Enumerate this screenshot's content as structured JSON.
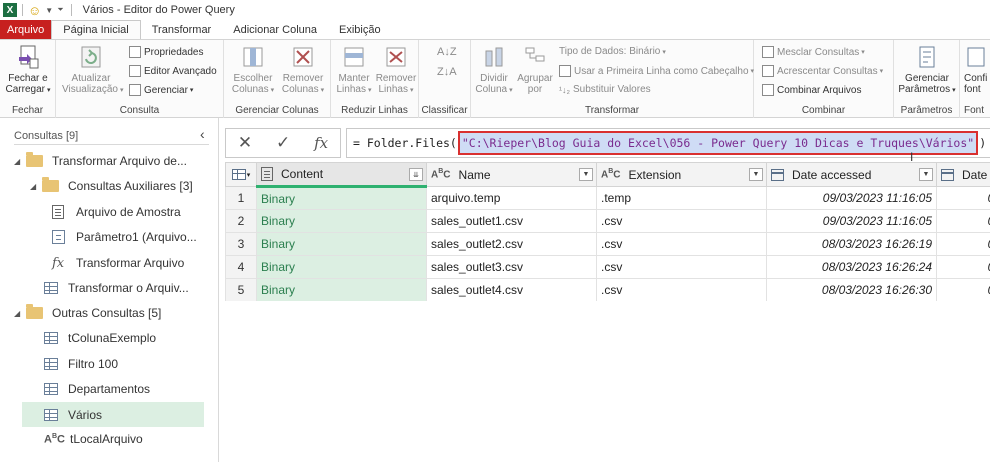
{
  "window": {
    "title": "Vários - Editor do Power Query",
    "app_logo": "X"
  },
  "ribbon_tabs": [
    {
      "label": "Arquivo"
    },
    {
      "label": "Página Inicial"
    },
    {
      "label": "Transformar"
    },
    {
      "label": "Adicionar Coluna"
    },
    {
      "label": "Exibição"
    }
  ],
  "ribbon": {
    "fechar": {
      "button": "Fechar e\nCarregar",
      "group": "Fechar"
    },
    "consulta": {
      "atualizar": "Atualizar\nVisualização",
      "propriedades": "Propriedades",
      "editor_avancado": "Editor Avançado",
      "gerenciar": "Gerenciar",
      "group": "Consulta"
    },
    "gerenciar_colunas": {
      "escolher": "Escolher\nColunas",
      "remover": "Remover\nColunas",
      "group": "Gerenciar Colunas"
    },
    "reduzir_linhas": {
      "manter": "Manter\nLinhas",
      "remover": "Remover\nLinhas",
      "group": "Reduzir Linhas"
    },
    "classificar": {
      "group": "Classificar"
    },
    "transformar": {
      "dividir": "Dividir\nColuna",
      "agrupar": "Agrupar\npor",
      "tipo_dados": "Tipo de Dados: Binário",
      "primeira_linha": "Usar a Primeira Linha como Cabeçalho",
      "substituir": "Substituir Valores",
      "group": "Transformar"
    },
    "combinar": {
      "mesclar": "Mesclar Consultas",
      "acrescentar": "Acrescentar Consultas",
      "combinar_arquivos": "Combinar Arquivos",
      "group": "Combinar"
    },
    "parametros": {
      "gerenciar": "Gerenciar\nParâmetros",
      "group": "Parâmetros"
    },
    "fontes": {
      "button": "Confi\nfont",
      "group": "Font"
    }
  },
  "queries_pane": {
    "header": "Consultas [9]",
    "items": [
      {
        "label": "Transformar Arquivo de..."
      },
      {
        "label": "Consultas Auxiliares [3]"
      },
      {
        "label": "Arquivo de Amostra"
      },
      {
        "label": "Parâmetro1 (Arquivo..."
      },
      {
        "label": "Transformar Arquivo"
      },
      {
        "label": "Transformar o Arquiv..."
      },
      {
        "label": "Outras Consultas [5]"
      },
      {
        "label": "tColunaExemplo"
      },
      {
        "label": "Filtro 100"
      },
      {
        "label": "Departamentos"
      },
      {
        "label": "Vários"
      },
      {
        "label": "tLocalArquivo"
      }
    ]
  },
  "formula_bar": {
    "prefix": "= Folder.Files(",
    "path": "\"C:\\Rieper\\Blog Guia do Excel\\056 - Power Query 10 Dicas e Truques\\Vários\"",
    "suffix": ")"
  },
  "grid": {
    "columns": [
      {
        "label": "Content",
        "type": "binary"
      },
      {
        "label": "Name",
        "type": "text"
      },
      {
        "label": "Extension",
        "type": "text"
      },
      {
        "label": "Date accessed",
        "type": "datetime"
      },
      {
        "label": "Date m",
        "type": "datetime"
      }
    ],
    "type_abc": "ABC",
    "rows": [
      {
        "n": "1",
        "content": "Binary",
        "name": "arquivo.temp",
        "ext": ".temp",
        "date": "09/03/2023 11:16:05",
        "datem": "0"
      },
      {
        "n": "2",
        "content": "Binary",
        "name": "sales_outlet1.csv",
        "ext": ".csv",
        "date": "09/03/2023 11:16:05",
        "datem": "0"
      },
      {
        "n": "3",
        "content": "Binary",
        "name": "sales_outlet2.csv",
        "ext": ".csv",
        "date": "08/03/2023 16:26:19",
        "datem": "0"
      },
      {
        "n": "4",
        "content": "Binary",
        "name": "sales_outlet3.csv",
        "ext": ".csv",
        "date": "08/03/2023 16:26:24",
        "datem": "0"
      },
      {
        "n": "5",
        "content": "Binary",
        "name": "sales_outlet4.csv",
        "ext": ".csv",
        "date": "08/03/2023 16:26:30",
        "datem": "0"
      }
    ]
  }
}
